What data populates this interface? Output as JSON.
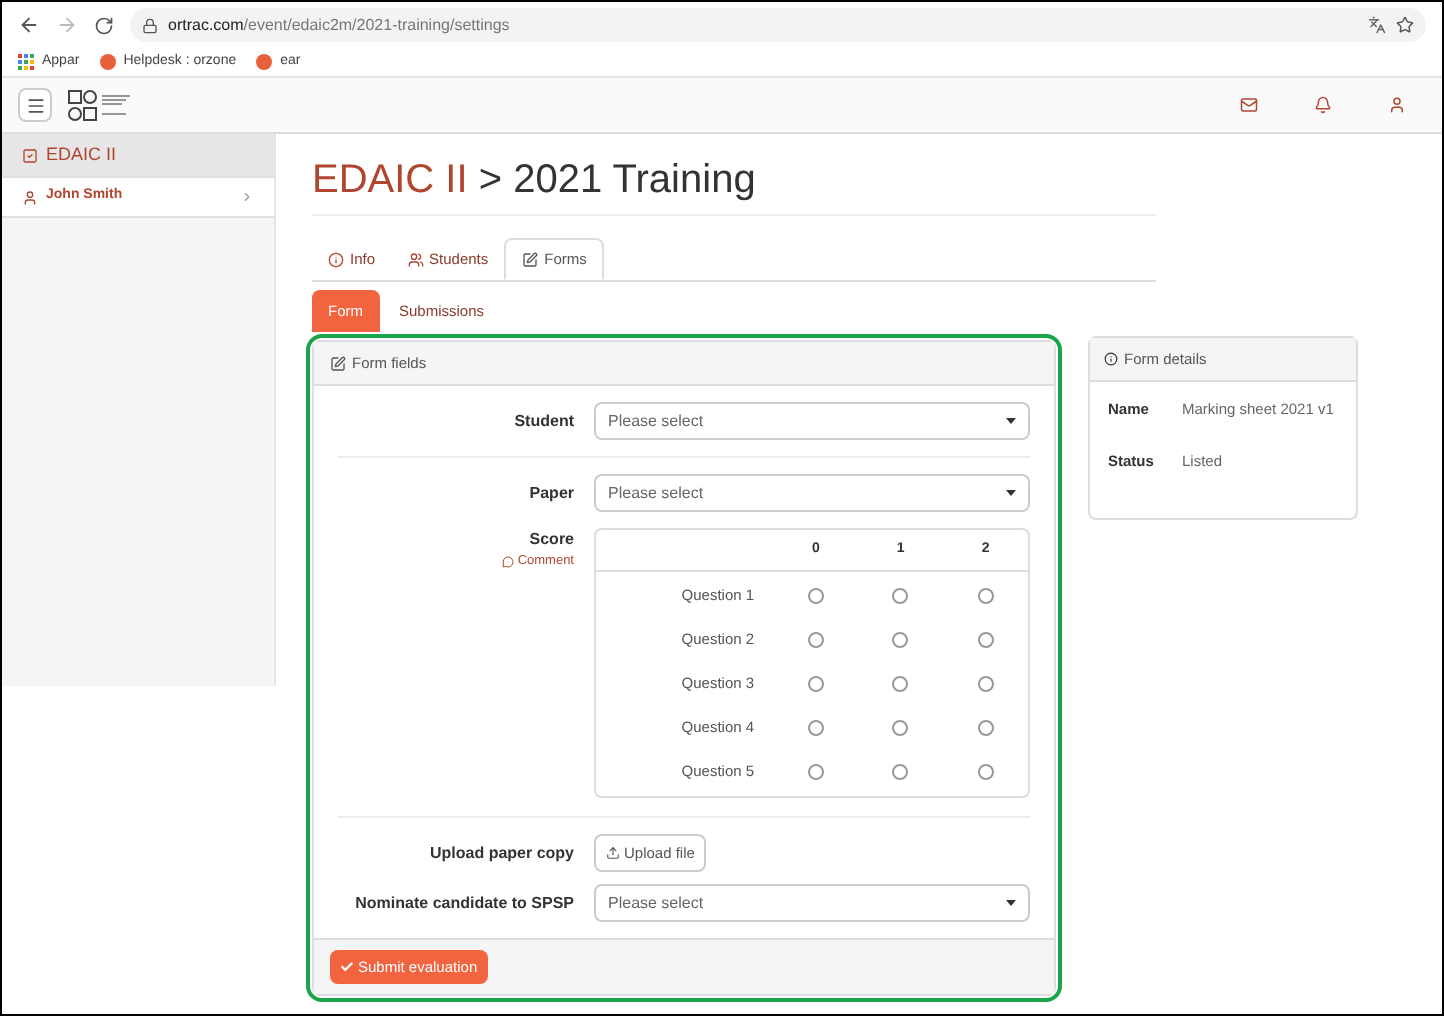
{
  "browser": {
    "url_host": "ortrac.com",
    "url_path": "/event/edaic2m/2021-training/settings",
    "bookmarks": [
      {
        "kind": "apps",
        "label": "Appar"
      },
      {
        "kind": "site",
        "label": "Helpdesk : orzone"
      },
      {
        "kind": "site",
        "label": "ear"
      }
    ]
  },
  "sidebar": {
    "items": [
      {
        "kind": "event",
        "label": "EDAIC II",
        "selected": true
      },
      {
        "kind": "user",
        "label": "John Smith",
        "selected": false
      }
    ]
  },
  "page_title": {
    "event": "EDAIC II",
    "separator": ">",
    "name": "2021 Training"
  },
  "tabs": [
    {
      "kind": "info",
      "label": "Info",
      "selected": false
    },
    {
      "kind": "students",
      "label": "Students",
      "selected": false
    },
    {
      "kind": "forms",
      "label": "Forms",
      "selected": true
    }
  ],
  "subtabs": [
    {
      "label": "Form",
      "selected": true
    },
    {
      "label": "Submissions",
      "selected": false
    }
  ],
  "form_panel": {
    "title": "Form fields",
    "student": {
      "label": "Student",
      "placeholder": "Please select"
    },
    "paper": {
      "label": "Paper",
      "placeholder": "Please select"
    },
    "score": {
      "label": "Score",
      "comment": "Comment",
      "columns": [
        "0",
        "1",
        "2"
      ],
      "rows": [
        {
          "label": "Question 1",
          "choices": [
            {
              "selected": false
            },
            {
              "selected": false
            },
            {
              "selected": false
            }
          ]
        },
        {
          "label": "Question 2",
          "choices": [
            {
              "selected": false
            },
            {
              "selected": false
            },
            {
              "selected": false
            }
          ]
        },
        {
          "label": "Question 3",
          "choices": [
            {
              "selected": false
            },
            {
              "selected": false
            },
            {
              "selected": false
            }
          ]
        },
        {
          "label": "Question 4",
          "choices": [
            {
              "selected": false
            },
            {
              "selected": false
            },
            {
              "selected": false
            }
          ]
        },
        {
          "label": "Question 5",
          "choices": [
            {
              "selected": false
            },
            {
              "selected": false
            },
            {
              "selected": false
            }
          ]
        }
      ]
    },
    "upload": {
      "label": "Upload paper copy",
      "button": "Upload file"
    },
    "nominate": {
      "label": "Nominate candidate to SPSP",
      "placeholder": "Please select"
    },
    "submit": "Submit evaluation"
  },
  "details_panel": {
    "title": "Form details",
    "rows": [
      {
        "label": "Name",
        "value": "Marking sheet 2021 v1"
      },
      {
        "label": "Status",
        "value": "Listed"
      }
    ]
  }
}
